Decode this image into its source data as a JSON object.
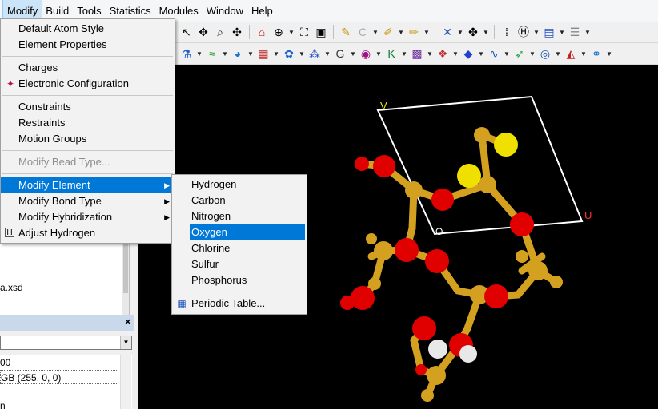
{
  "menubar": {
    "items": [
      {
        "label": "Modify"
      },
      {
        "label": "Build"
      },
      {
        "label": "Tools"
      },
      {
        "label": "Statistics"
      },
      {
        "label": "Modules"
      },
      {
        "label": "Window"
      },
      {
        "label": "Help"
      }
    ]
  },
  "modify_menu": {
    "items": [
      {
        "label": "Default Atom Style"
      },
      {
        "label": "Element Properties"
      },
      {
        "label": "Charges"
      },
      {
        "label": "Electronic Configuration",
        "icon": "atom-config-icon"
      },
      {
        "label": "Constraints"
      },
      {
        "label": "Restraints"
      },
      {
        "label": "Motion Groups"
      },
      {
        "label": "Modify Bead Type...",
        "disabled": true
      },
      {
        "label": "Modify Element",
        "submenu": true,
        "highlighted": true
      },
      {
        "label": "Modify Bond Type",
        "submenu": true
      },
      {
        "label": "Modify Hybridization",
        "submenu": true
      },
      {
        "label": "Adjust Hydrogen",
        "icon": "adjust-hydrogen-icon"
      }
    ]
  },
  "element_submenu": {
    "items": [
      {
        "label": "Hydrogen"
      },
      {
        "label": "Carbon"
      },
      {
        "label": "Nitrogen"
      },
      {
        "label": "Oxygen",
        "highlighted": true
      },
      {
        "label": "Chlorine"
      },
      {
        "label": "Sulfur"
      },
      {
        "label": "Phosphorus"
      },
      {
        "label": "Periodic Table...",
        "icon": "periodic-table-icon"
      }
    ]
  },
  "explorer": {
    "file_label": "a.xsd"
  },
  "properties": {
    "rows": [
      {
        "text": "00"
      },
      {
        "text": "GB (255, 0, 0)"
      },
      {
        "text": ""
      },
      {
        "text": "n"
      }
    ]
  },
  "viewport": {
    "cell_labels": {
      "a": "U",
      "b": "V",
      "origin": "O"
    },
    "colors": {
      "background": "#000000",
      "oxygen": "#e00000",
      "carbon": "#d4a020",
      "sulfur": "#f0e000",
      "hydrogen": "#e8e8e8",
      "cell": "#ffffff",
      "axis_u": "#ff3030",
      "axis_v": "#e6e600"
    }
  }
}
